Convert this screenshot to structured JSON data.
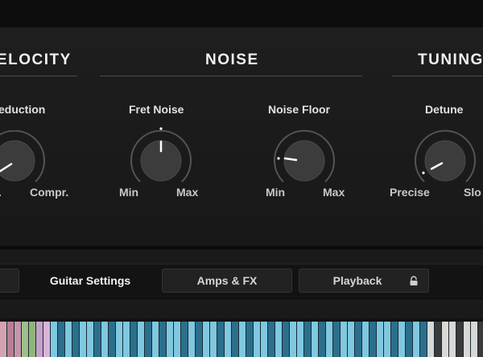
{
  "sections": {
    "velocity": {
      "title": "ELOCITY"
    },
    "noise": {
      "title": "NOISE"
    },
    "tuning": {
      "title": "TUNING"
    }
  },
  "params": {
    "reduction": {
      "label": "eduction",
      "min": ".",
      "max": "Compr."
    },
    "fret_noise": {
      "label": "Fret Noise",
      "min": "Min",
      "max": "Max"
    },
    "noise_floor": {
      "label": "Noise Floor",
      "min": "Min",
      "max": "Max"
    },
    "detune": {
      "label": "Detune",
      "min": "Precise",
      "max": "Slo"
    }
  },
  "tabs": [
    {
      "label": "Guitar Settings",
      "active": true
    },
    {
      "label": "Amps & FX",
      "active": false
    },
    {
      "label": "Playback",
      "active": false
    }
  ],
  "icons": {
    "playback_lock": "lock-icon"
  },
  "colors": {
    "panel": "#1b1b1b",
    "knob": "#3c3c3c",
    "arc": "#555555",
    "indicator": "#ffffff",
    "key_white": "#7fc8e0",
    "key_black": "#2b6f8c"
  }
}
